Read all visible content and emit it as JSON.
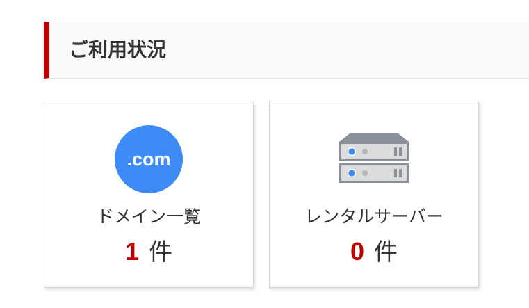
{
  "section": {
    "title": "ご利用状況"
  },
  "cards": [
    {
      "icon_text": ".com",
      "icon": "dotcom-icon",
      "label": "ドメイン一覧",
      "count": "1",
      "unit": "件"
    },
    {
      "icon": "server-icon",
      "label": "レンタルサーバー",
      "count": "0",
      "unit": "件"
    }
  ],
  "colors": {
    "accent": "#c00000",
    "dotcom_blue": "#3d8bf5",
    "server_gray": "#8a9099",
    "led_blue": "#3d8bf5"
  }
}
